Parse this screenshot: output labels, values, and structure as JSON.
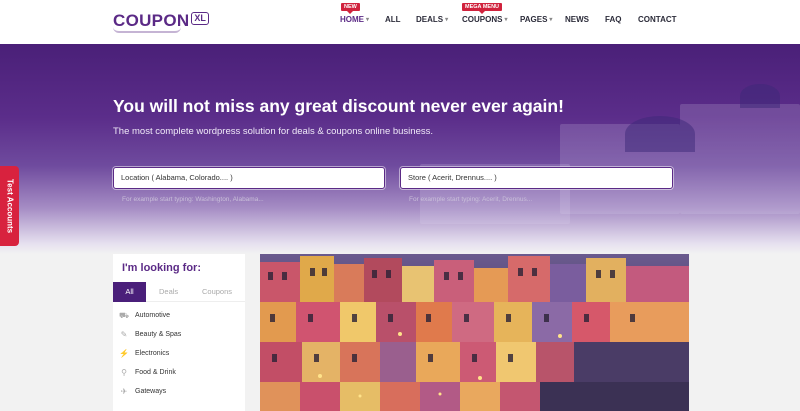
{
  "header": {
    "logo_text": "COUPON",
    "logo_suffix": "XL",
    "nav": [
      {
        "label": "HOME",
        "active": true,
        "caret": true,
        "badge": "NEW"
      },
      {
        "label": "ALL",
        "active": false,
        "caret": false
      },
      {
        "label": "DEALS",
        "active": false,
        "caret": true
      },
      {
        "label": "COUPONS",
        "active": false,
        "caret": true,
        "badge": "MEGA MENU"
      },
      {
        "label": "PAGES",
        "active": false,
        "caret": true
      },
      {
        "label": "NEWS",
        "active": false,
        "caret": false
      },
      {
        "label": "FAQ",
        "active": false,
        "caret": false
      },
      {
        "label": "CONTACT",
        "active": false,
        "caret": false
      }
    ]
  },
  "hero": {
    "title": "You will not miss any great discount never ever again!",
    "subtitle": "The most complete wordpress solution for deals & coupons online business.",
    "location_placeholder": "Location ( Alabama, Colorado.... )",
    "location_hint": "For example start typing: Washington, Alabama...",
    "store_placeholder": "Store ( Acerit, Drennus.... )",
    "store_hint": "For example start typing: Acerit, Drennus..."
  },
  "side_tab": {
    "label": "Test Accounts"
  },
  "looking_for": {
    "title": "I'm looking for:",
    "tabs": [
      "All",
      "Deals",
      "Coupons"
    ],
    "categories": [
      {
        "label": "Automotive",
        "icon": "car-icon"
      },
      {
        "label": "Beauty & Spas",
        "icon": "brush-icon"
      },
      {
        "label": "Electronics",
        "icon": "plug-icon"
      },
      {
        "label": "Food & Drink",
        "icon": "cutlery-icon"
      },
      {
        "label": "Gateways",
        "icon": "plane-icon"
      }
    ]
  },
  "colors": {
    "brand": "#5b2a86",
    "badge": "#d0223d",
    "side_tab": "#d8223e"
  }
}
